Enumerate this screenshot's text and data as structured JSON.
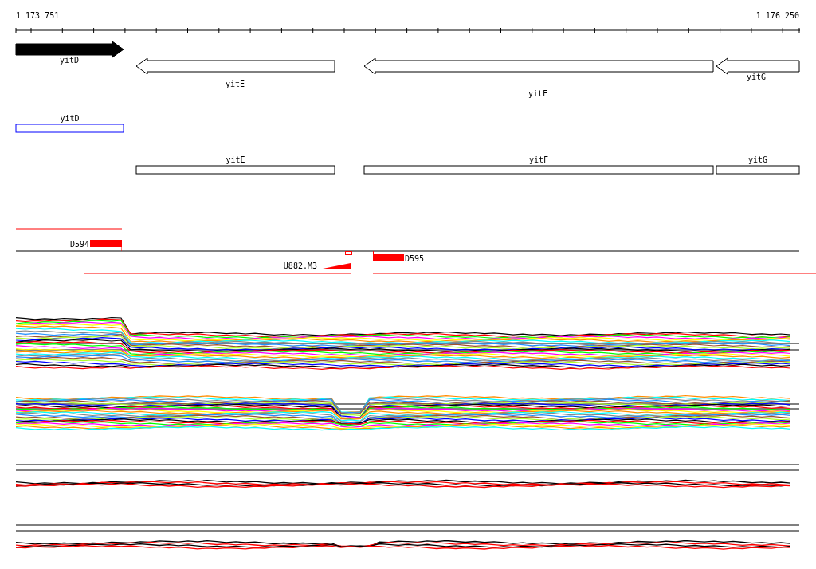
{
  "axis": {
    "start_label": "1 173 751",
    "end_label": "1 176 250"
  },
  "genes": [
    {
      "name": "yitD",
      "reverse": false,
      "filled": true
    },
    {
      "name": "yitE",
      "reverse": true,
      "filled": false
    },
    {
      "name": "yitF",
      "reverse": true,
      "filled": false
    },
    {
      "name": "yitG",
      "reverse": true,
      "filled": false
    }
  ],
  "gene_boxes": [
    {
      "name": "yitD",
      "highlighted": true
    },
    {
      "name": "yitE",
      "highlighted": false
    },
    {
      "name": "yitF",
      "highlighted": false
    },
    {
      "name": "yitG",
      "highlighted": false
    }
  ],
  "features": [
    {
      "kind": "bar",
      "name": "D594"
    },
    {
      "kind": "triangle",
      "name": "U882.M3"
    },
    {
      "kind": "bar",
      "name": "D595"
    }
  ]
}
